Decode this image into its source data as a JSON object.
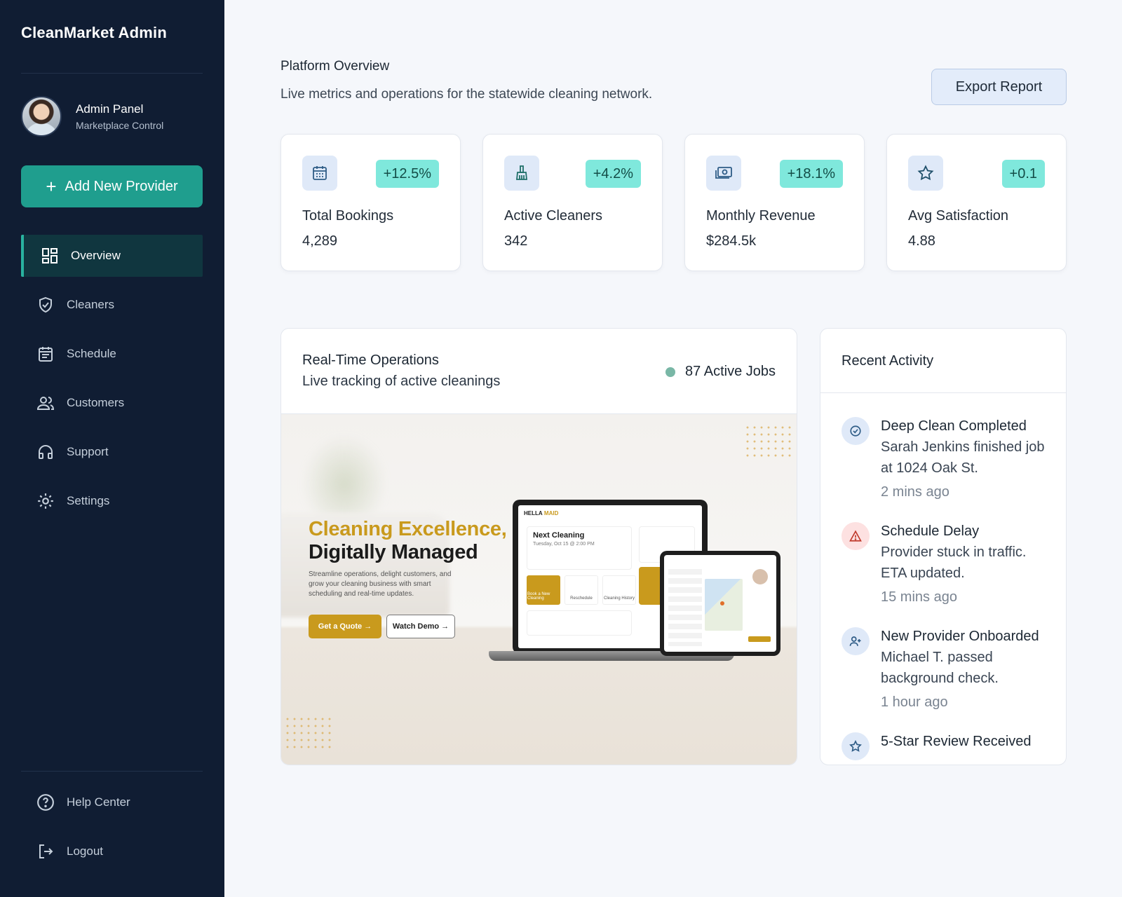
{
  "sidebar": {
    "brand": "CleanMarket Admin",
    "profile": {
      "name": "Admin Panel",
      "role": "Marketplace Control"
    },
    "add_button": {
      "label": "Add New Provider",
      "icon": "plus-icon"
    },
    "items": [
      {
        "label": "Overview",
        "icon": "grid-icon",
        "active": true
      },
      {
        "label": "Cleaners",
        "icon": "shield-check-icon"
      },
      {
        "label": "Schedule",
        "icon": "calendar-icon"
      },
      {
        "label": "Customers",
        "icon": "users-icon"
      },
      {
        "label": "Support",
        "icon": "headset-icon"
      },
      {
        "label": "Settings",
        "icon": "gear-icon"
      }
    ],
    "bottom_items": [
      {
        "label": "Help Center",
        "icon": "help-circle-icon"
      },
      {
        "label": "Logout",
        "icon": "logout-icon"
      }
    ]
  },
  "header": {
    "title": "Platform Overview",
    "subtitle": "Live metrics and operations for the statewide cleaning network.",
    "export_label": "Export Report"
  },
  "stats": [
    {
      "label": "Total Bookings",
      "value": "4,289",
      "change": "+12.5%",
      "icon": "calendar-icon"
    },
    {
      "label": "Active Cleaners",
      "value": "342",
      "change": "+4.2%",
      "icon": "broom-icon"
    },
    {
      "label": "Monthly Revenue",
      "value": "$284.5k",
      "change": "+18.1%",
      "icon": "money-icon"
    },
    {
      "label": "Avg Satisfaction",
      "value": "4.88",
      "change": "+0.1",
      "icon": "star-icon"
    }
  ],
  "operations": {
    "title": "Real-Time Operations",
    "subtitle": "Live tracking of active cleanings",
    "status": "87 Active Jobs",
    "status_color": "#79b7a6",
    "hero": {
      "title_line1": "Cleaning Excellence,",
      "title_line2": "Digitally Managed",
      "body": "Streamline operations, delight customers, and grow your cleaning business with smart scheduling and real-time updates.",
      "primary_cta": "Get a Quote →",
      "secondary_cta": "Watch Demo →",
      "screen_brand_a": "HELLA",
      "screen_brand_b": "MAID",
      "screen_next_title": "Next Cleaning",
      "screen_next_sub": "Tuesday, Oct 15 @ 2:00 PM",
      "screen_tiles": [
        "Book a New Cleaning",
        "Reschedule",
        "Cleaning History"
      ]
    }
  },
  "activity": {
    "title": "Recent Activity",
    "items": [
      {
        "title": "Deep Clean Completed",
        "desc": "Sarah Jenkins finished job at 1024 Oak St.",
        "time": "2 mins ago",
        "icon": "check-circle-icon",
        "tone": "blue"
      },
      {
        "title": "Schedule Delay",
        "desc": "Provider stuck in traffic. ETA updated.",
        "time": "15 mins ago",
        "icon": "warning-icon",
        "tone": "red"
      },
      {
        "title": "New Provider Onboarded",
        "desc": "Michael T. passed background check.",
        "time": "1 hour ago",
        "icon": "user-plus-icon",
        "tone": "blue"
      },
      {
        "title": "5-Star Review Received",
        "desc": "",
        "time": "",
        "icon": "star-icon",
        "tone": "blue"
      }
    ]
  },
  "colors": {
    "sidebar_bg": "#101d33",
    "accent": "#1f9e8e",
    "badge": "#7fe8dc",
    "gold": "#c99a1d"
  }
}
